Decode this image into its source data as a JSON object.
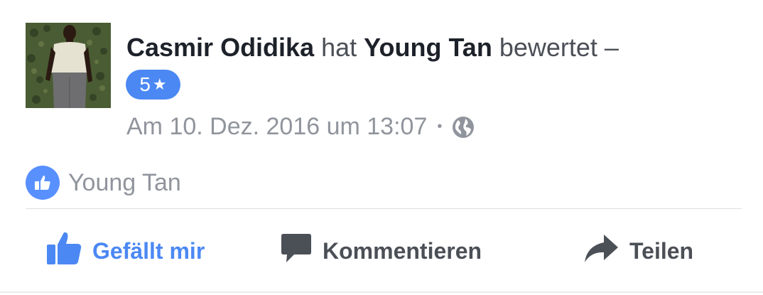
{
  "post": {
    "author": "Casmir Odidika",
    "verb_hat": "hat",
    "target": "Young Tan",
    "verb_bewertet": "bewertet –",
    "rating": "5",
    "rating_star": "★",
    "timestamp": "Am 10. Dez. 2016 um 13:07",
    "separator": "•",
    "privacy_icon": "globe-icon"
  },
  "likes": {
    "icon": "thumbs-up-icon",
    "liker": "Young Tan"
  },
  "actions": {
    "like_label": "Gefällt mir",
    "comment_label": "Kommentieren",
    "share_label": "Teilen"
  },
  "colors": {
    "accent": "#4b88f3",
    "text_dark": "#1d2129",
    "text_muted": "#90949c"
  }
}
